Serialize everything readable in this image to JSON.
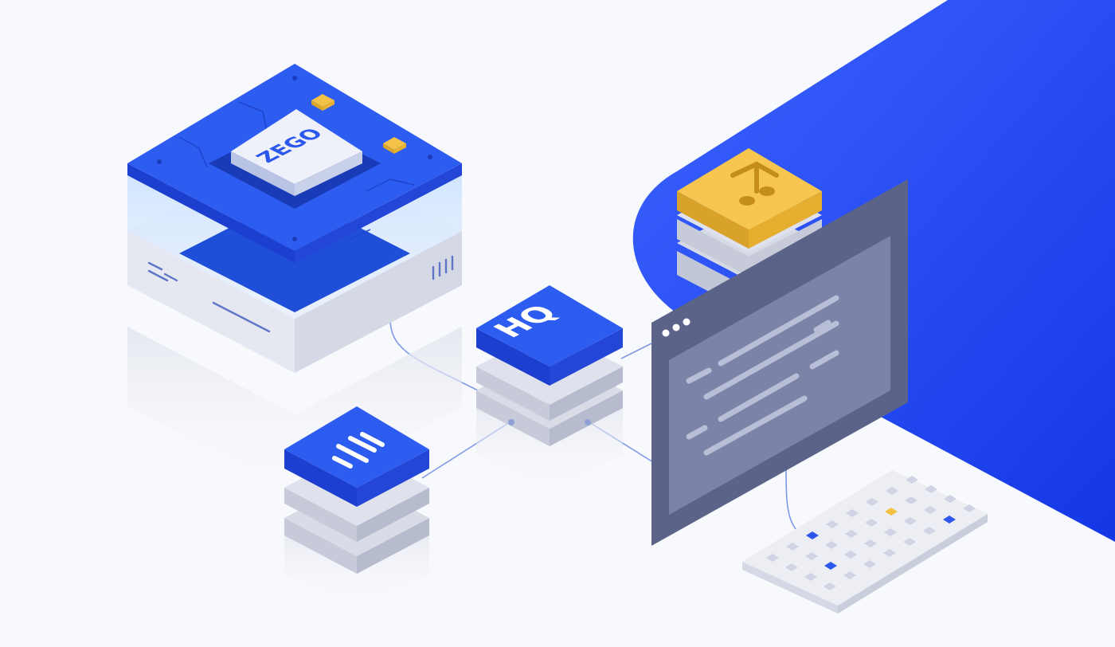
{
  "scene": {
    "logo_text": "ZEGO",
    "hq_badge": "HQ"
  },
  "colors": {
    "background": "#f8f9fc",
    "brand_blue": "#2b57ec",
    "brand_blue_dark": "#1c3fd0",
    "accent_yellow": "#f5c145",
    "window_slate": "#5a6386",
    "window_panel": "#7c83a6",
    "layer_gray": "#cfd3e3"
  },
  "icons": {
    "chip": "chip-icon",
    "hq": "hq-icon",
    "bars": "equalizer-icon",
    "music": "music-note-icon",
    "window": "app-window-icon",
    "keyboard": "keyboard-icon"
  }
}
